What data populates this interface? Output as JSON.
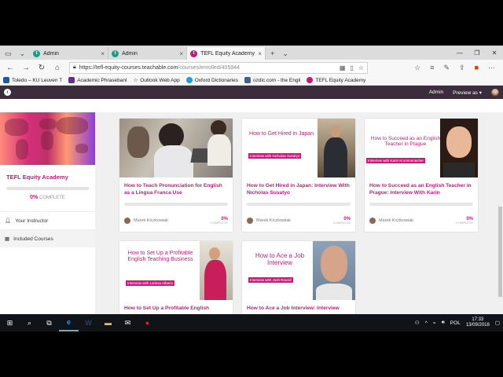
{
  "browser": {
    "tabs": [
      {
        "label": "Admin",
        "icon": "teachable-icon",
        "color": "#16a085"
      },
      {
        "label": "Admin",
        "icon": "teachable-icon",
        "color": "#16a085"
      },
      {
        "label": "TEFL Equity Academy",
        "icon": "teachable-icon",
        "color": "#c2197c"
      }
    ],
    "url_host": "https://tefl-equity-courses.teachable.com",
    "url_path": "/courses/enrolled/405944",
    "bookmarks": [
      {
        "label": "Toledo – KU Leuven T",
        "color": "#1c5aa6"
      },
      {
        "label": "Academic Phrasebanl",
        "color": "#6b2c91"
      },
      {
        "label": "Outlook Web App",
        "color": "#666666"
      },
      {
        "label": "Oxford Dictionaries",
        "color": "#1a9fd6"
      },
      {
        "label": "ozdic.com - the Engli",
        "color": "#44618f"
      },
      {
        "label": "TEFL Equity Academy",
        "color": "#c2197c"
      }
    ]
  },
  "site_header": {
    "admin_label": "Admin",
    "preview_label": "Preview as ▾"
  },
  "sidebar": {
    "course_title": "TEFL Equity Academy",
    "progress_value": "0%",
    "progress_label": "COMPLETE",
    "items": [
      {
        "label": "Your Instructor",
        "icon": "person-icon"
      },
      {
        "label": "Included Courses",
        "icon": "grid-icon"
      }
    ]
  },
  "cards": [
    {
      "thumb_title": "",
      "thumb_subtitle": "",
      "title": "How to Teach Pronunciation for English as a Lingua Franca Use",
      "author": "Marek Kiczkowiak",
      "pct": "0%",
      "pct_label": "COMPLETE"
    },
    {
      "thumb_title": "How to Get Hired in Japan",
      "thumb_subtitle": "Interview with Nicholas Susatyo",
      "title": "How to Get Hired in Japan: Interview With Nicholas Susatyo",
      "author": "Marek Kiczkowiak",
      "pct": "0%",
      "pct_label": "COMPLETE"
    },
    {
      "thumb_title": "How to Succeed as an English Teacher in Prague",
      "thumb_subtitle": "Interview with Karin Krummenacher",
      "title": "How to Succeed as an English Teacher in Prague: Interview With Karin",
      "author": "Marek Kiczkowiak",
      "pct": "0%",
      "pct_label": "COMPLETE"
    },
    {
      "thumb_title": "How to Set Up a Profitable English Teaching Business",
      "thumb_subtitle": "Interview with Larissa Albano",
      "title": "How to Set Up a Profitable English",
      "author": "",
      "pct": "",
      "pct_label": ""
    },
    {
      "thumb_title": "How to Ace a Job Interview",
      "thumb_subtitle": "Interview with Josh Round",
      "title": "How to Ace a Job Interview: Interview",
      "author": "",
      "pct": "",
      "pct_label": ""
    }
  ],
  "taskbar": {
    "language": "POL",
    "time": "17:33",
    "date": "13/09/2018"
  },
  "colors": {
    "brand": "#c2197c",
    "header": "#3b2d3b"
  }
}
